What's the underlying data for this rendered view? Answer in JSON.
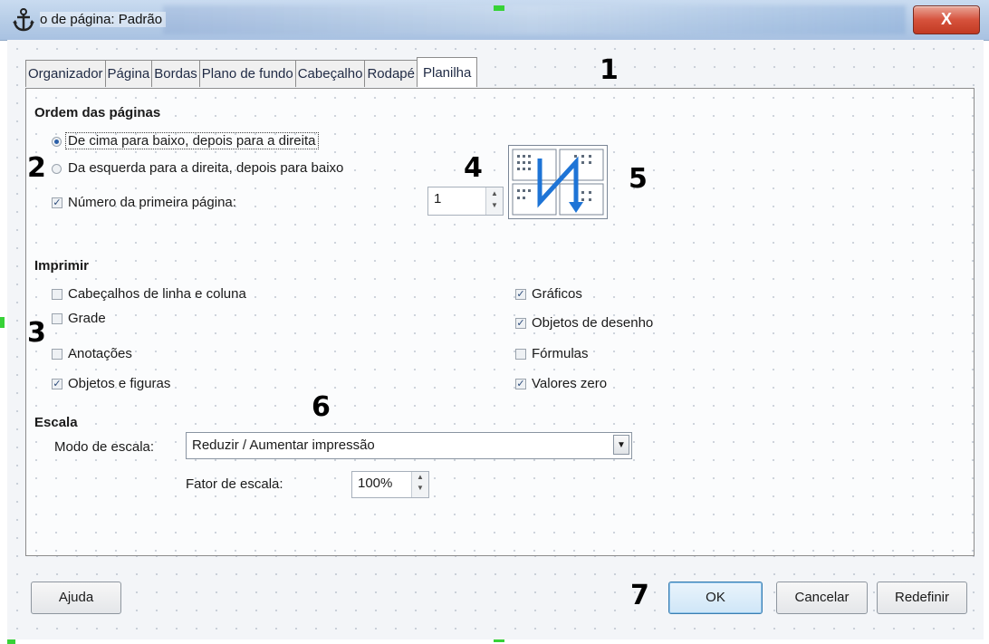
{
  "window": {
    "title": "o de página: Padrão",
    "close_label": "X"
  },
  "tabs": [
    {
      "label": "Organizador"
    },
    {
      "label": "Página"
    },
    {
      "label": "Bordas"
    },
    {
      "label": "Plano de fundo"
    },
    {
      "label": "Cabeçalho"
    },
    {
      "label": "Rodapé"
    },
    {
      "label": "Planilha",
      "active": true
    }
  ],
  "page_order": {
    "heading": "Ordem das páginas",
    "option_top_down": "De cima para baixo, depois para a direita",
    "option_left_right": "Da esquerda para a direita, depois para baixo",
    "first_page_label": "Número da primeira página:",
    "first_page_value": "1"
  },
  "print": {
    "heading": "Imprimir",
    "left": [
      {
        "label": "Cabeçalhos de linha e coluna",
        "checked": false
      },
      {
        "label": "Grade",
        "checked": false
      },
      {
        "label": "Anotações",
        "checked": false
      },
      {
        "label": "Objetos e figuras",
        "checked": true
      }
    ],
    "right": [
      {
        "label": "Gráficos",
        "checked": true
      },
      {
        "label": "Objetos de desenho",
        "checked": true
      },
      {
        "label": "Fórmulas",
        "checked": false
      },
      {
        "label": "Valores zero",
        "checked": true
      }
    ]
  },
  "scale": {
    "heading": "Escala",
    "mode_label": "Modo de escala:",
    "mode_value": "Reduzir / Aumentar impressão",
    "factor_label": "Fator de escala:",
    "factor_value": "100%"
  },
  "buttons": {
    "help": "Ajuda",
    "ok": "OK",
    "cancel": "Cancelar",
    "reset": "Redefinir"
  },
  "callouts": [
    "1",
    "2",
    "3",
    "4",
    "5",
    "6",
    "7"
  ],
  "colors": {
    "close_button": "#d6523c",
    "accent": "#2b5fa8",
    "preview_arrow": "#1e74d6"
  }
}
